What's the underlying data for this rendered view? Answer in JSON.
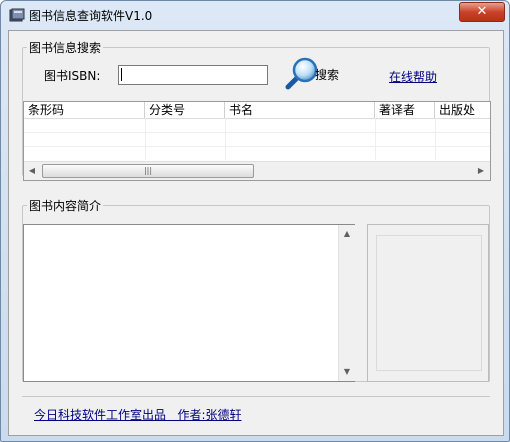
{
  "window": {
    "title": "图书信息查询软件V1.0",
    "close_glyph": "✕"
  },
  "search": {
    "group_title": "图书信息搜索",
    "isbn_label": "图书ISBN:",
    "isbn_value": "",
    "search_label": "搜索",
    "help_link": "在线帮助"
  },
  "table": {
    "columns": [
      "条形码",
      "分类号",
      "书名",
      "著译者",
      "出版处"
    ],
    "rows": []
  },
  "intro": {
    "group_title": "图书内容简介",
    "text": ""
  },
  "footer": {
    "credit": "今日科技软件工作室出品   作者:张德轩"
  },
  "colors": {
    "link": "#000080",
    "close": "#c8432a",
    "titlebar": "#dce8f5"
  }
}
